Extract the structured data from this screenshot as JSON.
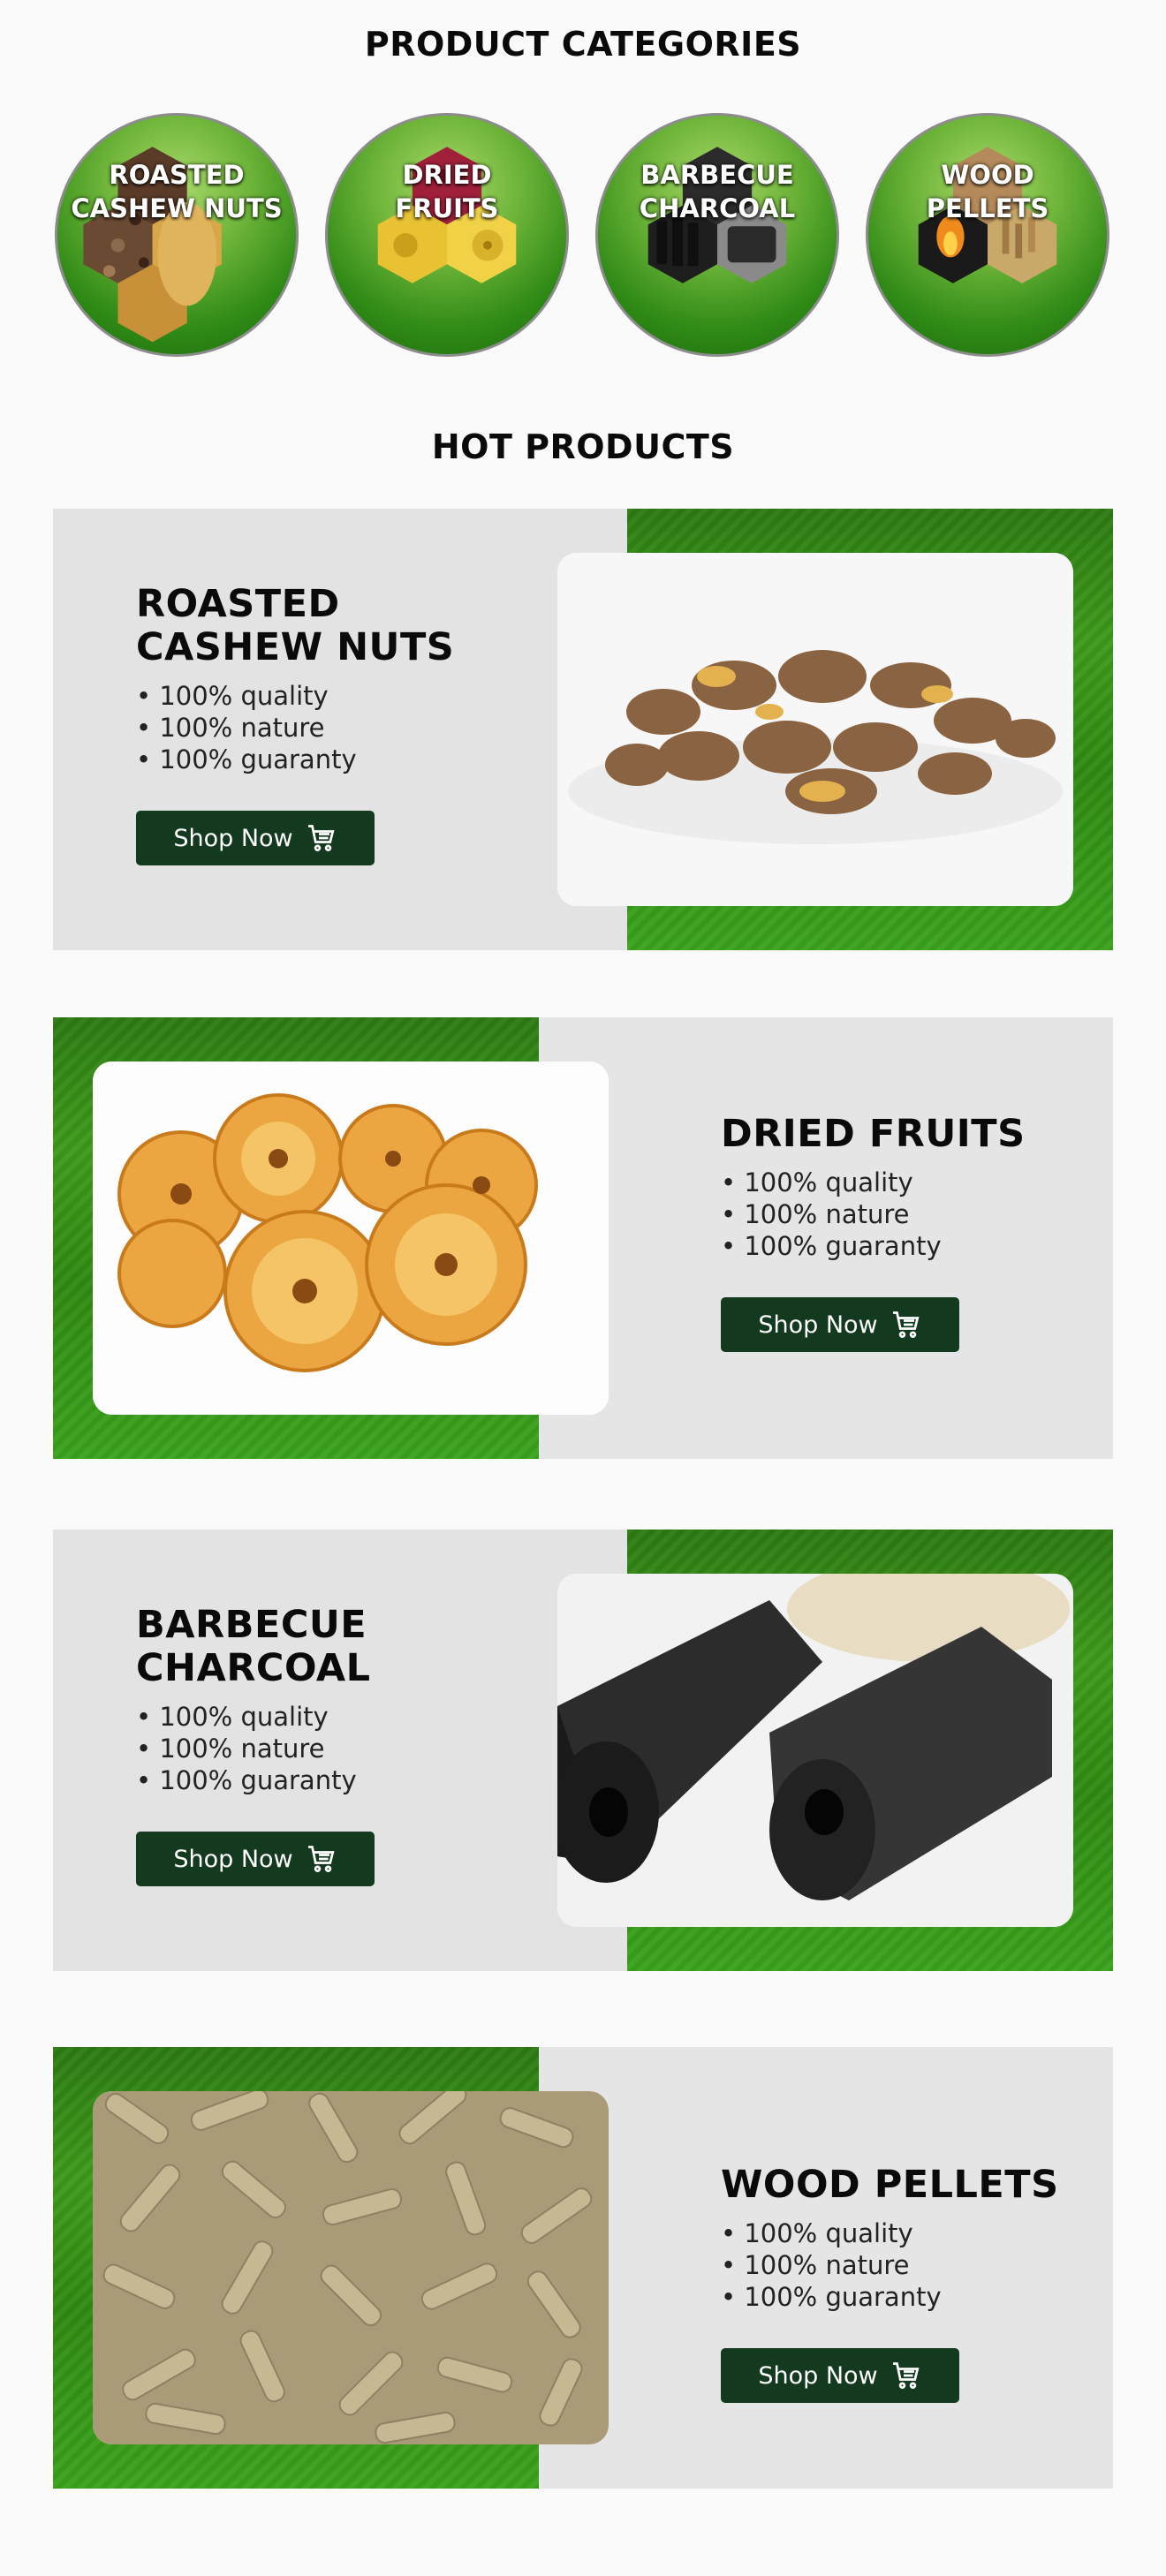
{
  "categories_title": "PRODUCT CATEGORIES",
  "hot_title": "HOT PRODUCTS",
  "categories": [
    {
      "line1": "ROASTED",
      "line2": "CASHEW NUTS"
    },
    {
      "line1": "DRIED",
      "line2": "FRUITS"
    },
    {
      "line1": "BARBECUE",
      "line2": "CHARCOAL"
    },
    {
      "line1": "WOOD",
      "line2": "PELLETS"
    }
  ],
  "products": [
    {
      "title": "ROASTED\nCASHEW NUTS",
      "f1": "• 100% quality",
      "f2": "• 100% nature",
      "f3": "• 100% guaranty",
      "button": "Shop Now"
    },
    {
      "title": "DRIED FRUITS",
      "f1": "• 100% quality",
      "f2": "• 100% nature",
      "f3": "• 100% guaranty",
      "button": "Shop Now"
    },
    {
      "title": "BARBECUE\nCHARCOAL",
      "f1": "• 100% quality",
      "f2": "• 100% nature",
      "f3": "• 100% guaranty",
      "button": "Shop Now"
    },
    {
      "title": "WOOD PELLETS",
      "f1": "• 100% quality",
      "f2": "• 100% nature",
      "f3": "• 100% guaranty",
      "button": "Shop Now"
    }
  ],
  "colors": {
    "button": "#13391f",
    "green": "#2f8a12",
    "card": "#e3e3e3"
  },
  "icons": {
    "button_icon": "shopping-cart-icon"
  }
}
